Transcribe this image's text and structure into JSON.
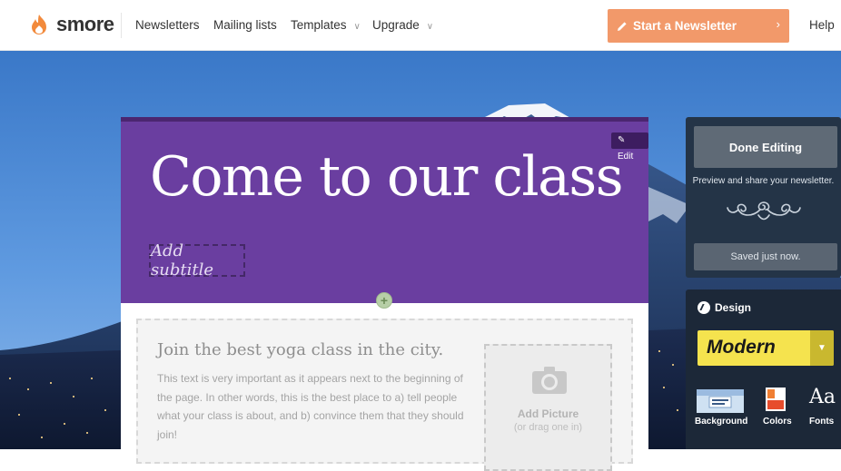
{
  "nav": {
    "brand": "smore",
    "links": [
      {
        "label": "Newsletters"
      },
      {
        "label": "Mailing lists"
      },
      {
        "label": "Templates",
        "has_dropdown": true
      },
      {
        "label": "Upgrade",
        "has_dropdown": true
      }
    ],
    "cta_label": "Start a Newsletter",
    "cta_arrow": "›",
    "help_label": "Help",
    "cta_color": "#f2996a"
  },
  "newsletter": {
    "edit_label": "Edit",
    "title": "Come to our class",
    "subtitle_placeholder": "Add subtitle",
    "add_block_symbol": "+",
    "header_color": "#6a3ea0",
    "section": {
      "heading": "Join the best yoga class in the city.",
      "body": "This text is very important as it appears next to the beginning of the page. In other words, this is the best place to a) tell people what your class is about, and b) convince them that they should join!",
      "add_picture_label": "Add Picture",
      "add_picture_sub": "(or drag one in)"
    }
  },
  "sidebar": {
    "done_label": "Done Editing",
    "preview_text": "Preview and share your newsletter.",
    "saved_text": "Saved just now.",
    "design_label": "Design",
    "theme_name": "Modern",
    "theme_caret": "▼",
    "tools": [
      {
        "label": "Background",
        "icon": "background-icon"
      },
      {
        "label": "Colors",
        "icon": "colors-icon"
      },
      {
        "label": "Fonts",
        "icon": "fonts-icon",
        "glyph": "Aa"
      }
    ],
    "theme_color": "#f5e34e"
  }
}
